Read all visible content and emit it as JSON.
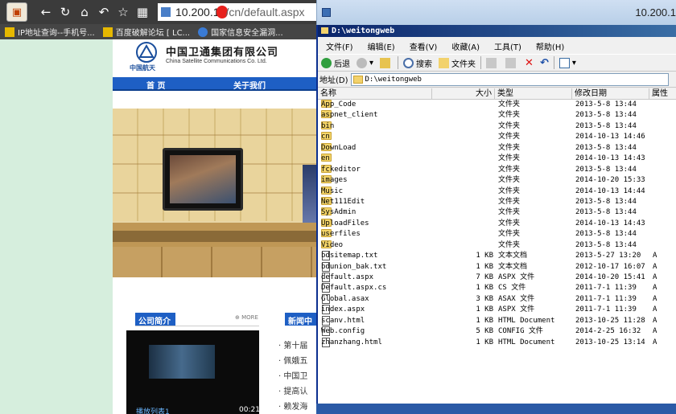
{
  "browser": {
    "url_host": "10.200.1",
    "url_path": "/cn/default.aspx",
    "bookmarks": [
      "IP地址查询--手机号...",
      "百度破解论坛 [ LC...",
      "国家信息安全漏洞..."
    ]
  },
  "site": {
    "logo_caption": "中国航天",
    "company_cn": "中国卫通集团有限公司",
    "company_en": "China Satellite Communications Co. Ltd.",
    "nav": [
      "首 页",
      "关于我们"
    ],
    "section1_title": "公司简介",
    "more": "MORE",
    "section2_title": "新闻中",
    "video_label": "播放列表1",
    "video_time": "00:21",
    "news": [
      "第十届",
      "佩娥五",
      "中国卫",
      "提高认",
      "赖发海"
    ]
  },
  "explorer": {
    "window_title": "10.200.1",
    "caption": "D:\\weitongweb",
    "menu": [
      "文件(F)",
      "编辑(E)",
      "查看(V)",
      "收藏(A)",
      "工具(T)",
      "帮助(H)"
    ],
    "toolbar": {
      "back": "后退",
      "search": "搜索",
      "folders": "文件夹"
    },
    "address_label": "地址(D)",
    "address_value": "D:\\weitongweb",
    "columns": {
      "name": "名称",
      "size": "大小",
      "type": "类型",
      "modified": "修改日期",
      "attr": "属性"
    },
    "files": [
      {
        "name": "App_Code",
        "size": "",
        "type": "文件夹",
        "date": "2013-5-8 13:44",
        "attr": "",
        "kind": "folder"
      },
      {
        "name": "aspnet_client",
        "size": "",
        "type": "文件夹",
        "date": "2013-5-8 13:44",
        "attr": "",
        "kind": "folder"
      },
      {
        "name": "bin",
        "size": "",
        "type": "文件夹",
        "date": "2013-5-8 13:44",
        "attr": "",
        "kind": "folder"
      },
      {
        "name": "cn",
        "size": "",
        "type": "文件夹",
        "date": "2014-10-13 14:46",
        "attr": "",
        "kind": "folder"
      },
      {
        "name": "DownLoad",
        "size": "",
        "type": "文件夹",
        "date": "2013-5-8 13:44",
        "attr": "",
        "kind": "folder"
      },
      {
        "name": "en",
        "size": "",
        "type": "文件夹",
        "date": "2014-10-13 14:43",
        "attr": "",
        "kind": "folder"
      },
      {
        "name": "fckeditor",
        "size": "",
        "type": "文件夹",
        "date": "2013-5-8 13:44",
        "attr": "",
        "kind": "folder"
      },
      {
        "name": "images",
        "size": "",
        "type": "文件夹",
        "date": "2014-10-20 15:33",
        "attr": "",
        "kind": "folder"
      },
      {
        "name": "Music",
        "size": "",
        "type": "文件夹",
        "date": "2014-10-13 14:44",
        "attr": "",
        "kind": "folder"
      },
      {
        "name": "Net111Edit",
        "size": "",
        "type": "文件夹",
        "date": "2013-5-8 13:44",
        "attr": "",
        "kind": "folder"
      },
      {
        "name": "SysAdmin",
        "size": "",
        "type": "文件夹",
        "date": "2013-5-8 13:44",
        "attr": "",
        "kind": "folder"
      },
      {
        "name": "UploadFiles",
        "size": "",
        "type": "文件夹",
        "date": "2014-10-13 14:43",
        "attr": "",
        "kind": "folder"
      },
      {
        "name": "userfiles",
        "size": "",
        "type": "文件夹",
        "date": "2013-5-8 13:44",
        "attr": "",
        "kind": "folder"
      },
      {
        "name": "Video",
        "size": "",
        "type": "文件夹",
        "date": "2013-5-8 13:44",
        "attr": "",
        "kind": "folder"
      },
      {
        "name": "bdsitemap.txt",
        "size": "1 KB",
        "type": "文本文档",
        "date": "2013-5-27 13:20",
        "attr": "A",
        "kind": "file"
      },
      {
        "name": "bdunion_bak.txt",
        "size": "1 KB",
        "type": "文本文档",
        "date": "2012-10-17 16:07",
        "attr": "A",
        "kind": "file"
      },
      {
        "name": "default.aspx",
        "size": "7 KB",
        "type": "ASPX 文件",
        "date": "2014-10-20 15:41",
        "attr": "A",
        "kind": "file"
      },
      {
        "name": "Default.aspx.cs",
        "size": "1 KB",
        "type": "CS 文件",
        "date": "2011-7-1 11:39",
        "attr": "A",
        "kind": "file"
      },
      {
        "name": "Global.asax",
        "size": "3 KB",
        "type": "ASAX 文件",
        "date": "2011-7-1 11:39",
        "attr": "A",
        "kind": "file"
      },
      {
        "name": "index.aspx",
        "size": "1 KB",
        "type": "ASPX 文件",
        "date": "2011-7-1 11:39",
        "attr": "A",
        "kind": "file"
      },
      {
        "name": "scanv.html",
        "size": "1 KB",
        "type": "HTML Document",
        "date": "2013-10-25 11:28",
        "attr": "A",
        "kind": "file"
      },
      {
        "name": "Web.config",
        "size": "5 KB",
        "type": "CONFIG 文件",
        "date": "2014-2-25 16:32",
        "attr": "A",
        "kind": "file"
      },
      {
        "name": "zhanzhang.html",
        "size": "1 KB",
        "type": "HTML Document",
        "date": "2013-10-25 13:14",
        "attr": "A",
        "kind": "file"
      }
    ]
  }
}
